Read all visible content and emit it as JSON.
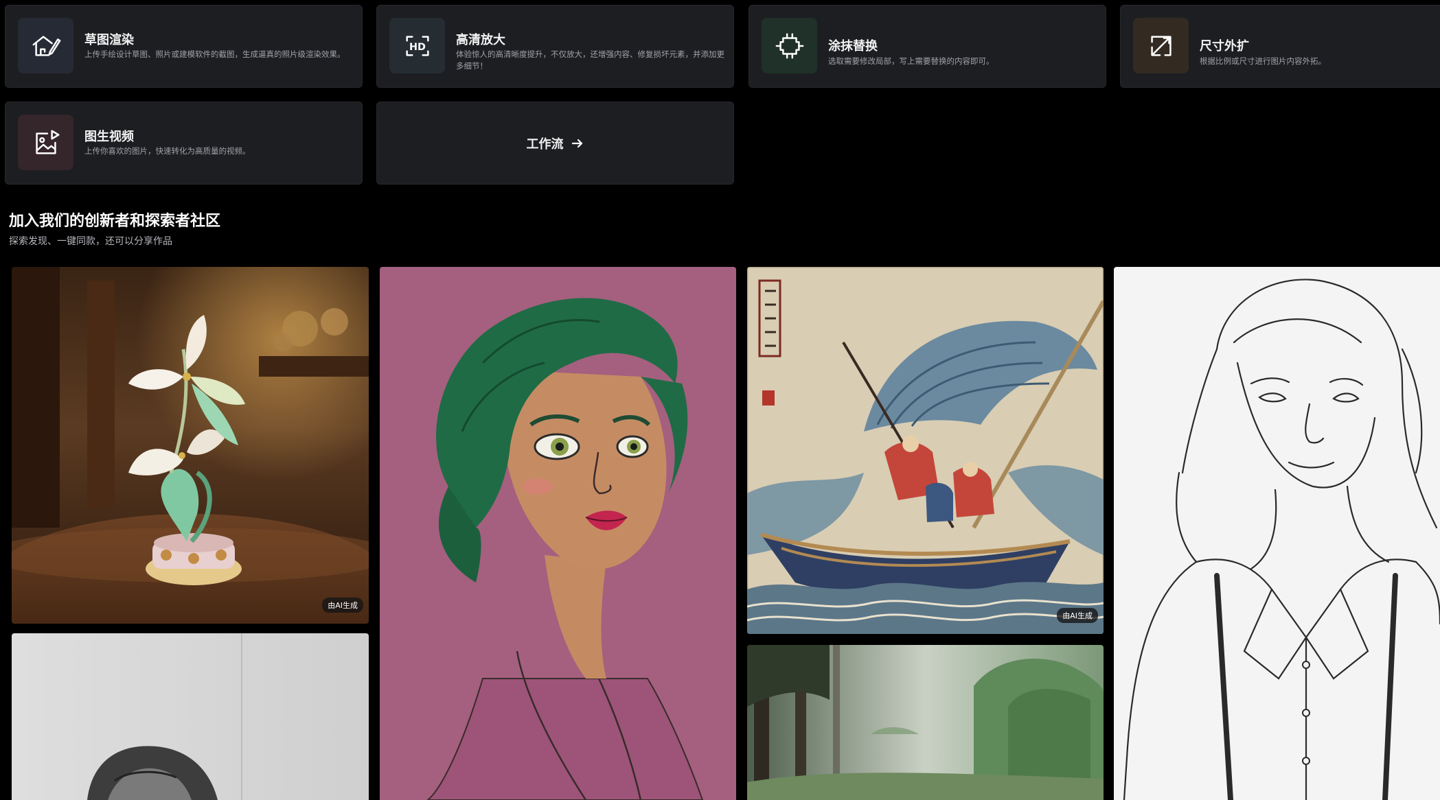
{
  "tools": [
    {
      "title": "草图渲染",
      "desc": "上传手绘设计草图、照片或建模软件的截图，生成逼真的照片级渲染效果。",
      "icon": "house-sketch-icon"
    },
    {
      "title": "高清放大",
      "desc": "体验惊人的高清晰度提升，不仅放大，还增强内容、修复损坏元素，并添加更多细节！",
      "icon": "hd-icon",
      "icon_text": "HD"
    },
    {
      "title": "涂抹替换",
      "desc": "选取需要修改局部，写上需要替换的内容即可。",
      "icon": "brush-select-icon"
    },
    {
      "title": "尺寸外扩",
      "desc": "根据比例或尺寸进行图片内容外拓。",
      "icon": "expand-arrows-icon"
    },
    {
      "title": "图生视频",
      "desc": "上传你喜欢的图片，快速转化为高质量的视频。",
      "icon": "image-video-icon"
    }
  ],
  "workflow": {
    "label": "工作流",
    "icon": "arrow-right-icon"
  },
  "community": {
    "title": "加入我们的创新者和探索者社区",
    "subtitle": "探索发现、一键同款，还可以分享作品"
  },
  "gallery": {
    "badge_label": "由AI生成",
    "items": [
      {
        "subject": "flower-sculpture",
        "has_badge": true
      },
      {
        "subject": "woman-sketch",
        "has_badge": false
      },
      {
        "subject": "green-hair-woman",
        "has_badge": false
      },
      {
        "subject": "ukiyoe-boat",
        "has_badge": true
      },
      {
        "subject": "misty-forest",
        "has_badge": false
      },
      {
        "subject": "woman-lineart",
        "has_badge": false
      }
    ]
  },
  "colors": {
    "background": "#000000",
    "card": "#1d1e22",
    "icon_bg_blue": "#262c38",
    "icon_bg_green": "#1f3228",
    "icon_bg_brown": "#342b22",
    "icon_bg_red": "#33262a"
  }
}
